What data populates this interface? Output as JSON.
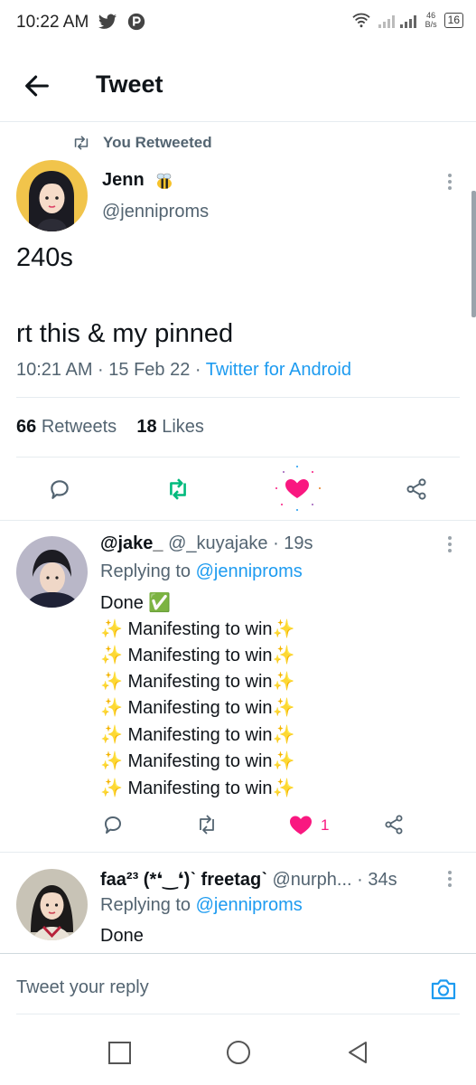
{
  "status_bar": {
    "time": "10:22 AM",
    "net_speed_top": "46",
    "net_speed_bottom": "B/s",
    "battery": "16"
  },
  "header": {
    "title": "Tweet"
  },
  "main_tweet": {
    "retweeted_label": "You Retweeted",
    "author_name": "Jenn",
    "author_handle": "@jenniproms",
    "text_line1": "240s",
    "text_line2": "rt this & my pinned",
    "timestamp": "10:21 AM · 15 Feb 22 · ",
    "client": "Twitter for Android",
    "retweets_count": "66",
    "retweets_label": "Retweets",
    "likes_count": "18",
    "likes_label": "Likes"
  },
  "replies": [
    {
      "name": "@jake_",
      "handle": "@_kuyajake",
      "time": "· 19s",
      "replying_label": "Replying to",
      "replying_to": "@jenniproms",
      "lines": [
        "Done ✅",
        "✨ Manifesting to win✨",
        "✨ Manifesting to win✨",
        "✨ Manifesting to win✨",
        "✨ Manifesting to win✨",
        "✨ Manifesting to win✨",
        "✨ Manifesting to win✨",
        "✨ Manifesting to win✨"
      ],
      "like_count": "1"
    },
    {
      "name": "faa²³ (*❛‿❛)ˋ freetagˋ",
      "handle": "@nurph...",
      "time": "· 34s",
      "replying_label": "Replying to",
      "replying_to": "@jenniproms",
      "lines": [
        "Done"
      ]
    }
  ],
  "reply_bar": {
    "placeholder": "Tweet your reply"
  },
  "colors": {
    "accent": "#1d9bf0",
    "retweet_green": "#00ba7c",
    "like_pink": "#f91880",
    "secondary_text": "#536471"
  }
}
